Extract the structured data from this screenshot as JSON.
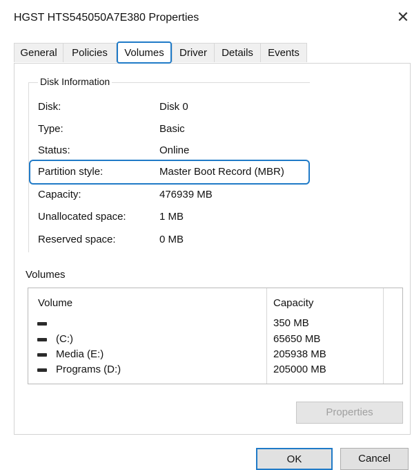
{
  "window": {
    "title": "HGST HTS545050A7E380 Properties",
    "close_glyph": "✕"
  },
  "tabs": [
    {
      "label": "General"
    },
    {
      "label": "Policies"
    },
    {
      "label": "Volumes",
      "active": true
    },
    {
      "label": "Driver"
    },
    {
      "label": "Details"
    },
    {
      "label": "Events"
    }
  ],
  "disk_info": {
    "legend": "Disk Information",
    "rows": [
      {
        "label": "Disk:",
        "value": "Disk 0"
      },
      {
        "label": "Type:",
        "value": "Basic"
      },
      {
        "label": "Status:",
        "value": "Online"
      },
      {
        "label": "Partition style:",
        "value": "Master Boot Record (MBR)"
      },
      {
        "label": "Capacity:",
        "value": "476939 MB"
      },
      {
        "label": "Unallocated space:",
        "value": "1 MB"
      },
      {
        "label": "Reserved space:",
        "value": "0 MB"
      }
    ]
  },
  "volumes": {
    "title": "Volumes",
    "columns": {
      "volume": "Volume",
      "capacity": "Capacity"
    },
    "items": [
      {
        "name": "",
        "capacity": "350 MB",
        "icon": "drive-icon"
      },
      {
        "name": "(C:)",
        "capacity": "65650 MB",
        "icon": "drive-icon"
      },
      {
        "name": "Media (E:)",
        "capacity": "205938 MB",
        "icon": "drive-icon"
      },
      {
        "name": "Programs (D:)",
        "capacity": "205000 MB",
        "icon": "drive-icon"
      }
    ],
    "properties_button": "Properties"
  },
  "footer": {
    "ok_label": "OK",
    "cancel_label": "Cancel"
  },
  "colors": {
    "highlight": "#1f7ac7"
  }
}
